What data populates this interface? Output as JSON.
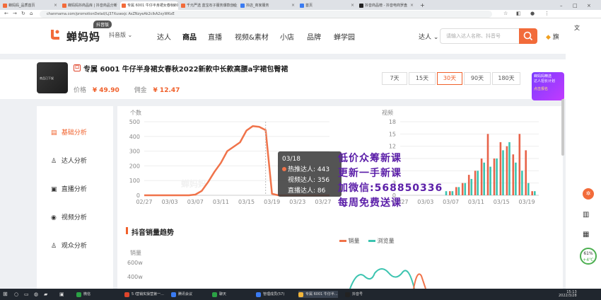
{
  "browser": {
    "tabs": [
      {
        "label": "蝉妈妈_品质首页",
        "color": "#f26b3a",
        "active": false
      },
      {
        "label": "蝉妈妈抖商品库 | 抖音商品分析",
        "color": "#f26b3a",
        "active": false
      },
      {
        "label": "专属 6001 牛仔半身裙女春秋2022新款",
        "color": "#f26b3a",
        "active": true
      },
      {
        "label": "千元严选 蓝宝石子服务爆款创业",
        "color": "#f26b3a",
        "active": false
      },
      {
        "label": "抖店_商家服务",
        "color": "#3a7bf2",
        "active": false
      },
      {
        "label": "首页",
        "color": "#3a7bf2",
        "active": false
      },
      {
        "label": "抖音商品榜 - 抖音电商罗盘",
        "color": "#222222",
        "active": false
      }
    ],
    "url": "chanmama.com/promotionDetail/Lj37Xusexjc AsZNzyeAk2clkA2xyWKxE"
  },
  "site": {
    "logo_text": "蝉妈妈",
    "logo_badge": "抖音版",
    "version_select": "抖音版",
    "nav": [
      "达人",
      "商品",
      "直播",
      "视频&素材",
      "小店",
      "品牌",
      "蝉学园"
    ],
    "search_scope": "达人",
    "search_placeholder": "请输入达人名称、抖音号",
    "flagship_label": "旗"
  },
  "product": {
    "badge": "口",
    "title": "专属 6001 牛仔半身裙女春秋2022新款中长款高腰a字裙包臀裙",
    "price_label": "价格",
    "price": "¥ 49.90",
    "commission_label": "佣金",
    "commission": "¥ 12.47",
    "thumb_caption": "商品已下架",
    "ranges": [
      "7天",
      "15天",
      "30天",
      "90天",
      "180天"
    ],
    "active_range": "30天"
  },
  "promo": {
    "line1": "蝉妈妈精选",
    "line2": "达人招长计划",
    "line3": "点击报名"
  },
  "sidebar": {
    "items": [
      {
        "label": "基础分析",
        "icon": "chart-icon",
        "active": true
      },
      {
        "label": "达人分析",
        "icon": "user-icon",
        "active": false
      },
      {
        "label": "直播分析",
        "icon": "tv-icon",
        "active": false
      },
      {
        "label": "视频分析",
        "icon": "play-icon",
        "active": false
      },
      {
        "label": "观众分析",
        "icon": "audience-icon",
        "active": false
      }
    ]
  },
  "chart_data": [
    {
      "type": "line",
      "ylabel": "个数",
      "ylim": [
        0,
        500
      ],
      "yticks": [
        0,
        100,
        200,
        300,
        400,
        500
      ],
      "x_tick_labels": [
        "02/27",
        "03/03",
        "03/07",
        "03/11",
        "03/15",
        "03/19",
        "03/23",
        "03/27"
      ],
      "x": [
        "02/27",
        "02/28",
        "03/01",
        "03/02",
        "03/03",
        "03/04",
        "03/05",
        "03/06",
        "03/07",
        "03/08",
        "03/09",
        "03/10",
        "03/11",
        "03/12",
        "03/13",
        "03/14",
        "03/15",
        "03/16",
        "03/17",
        "03/18",
        "03/19",
        "03/20",
        "03/21",
        "03/22",
        "03/23",
        "03/24",
        "03/25",
        "03/26",
        "03/27",
        "03/28"
      ],
      "series": [
        {
          "name": "热推达人",
          "color": "#f0734a",
          "values": [
            0,
            0,
            0,
            0,
            0,
            0,
            0,
            0,
            5,
            30,
            90,
            160,
            220,
            300,
            330,
            360,
            440,
            470,
            465,
            443,
            10,
            0,
            0,
            0,
            0,
            0,
            0,
            0,
            0,
            0
          ]
        }
      ],
      "watermark": "蝉妈妈"
    },
    {
      "type": "bar",
      "ylabel": "视频",
      "ylim": [
        0,
        18
      ],
      "yticks": [
        0,
        3,
        6,
        9,
        12,
        15,
        18
      ],
      "x_tick_labels": [
        "02/27",
        "03/03",
        "03/07",
        "03/11",
        "03/15",
        "03/19"
      ],
      "x": [
        "03/06",
        "03/07",
        "03/08",
        "03/09",
        "03/10",
        "03/11",
        "03/12",
        "03/13",
        "03/14",
        "03/15",
        "03/16",
        "03/17",
        "03/18",
        "03/19",
        "03/20"
      ],
      "series": [
        {
          "name": "视频达人",
          "color": "#e8634a",
          "values": [
            0,
            1,
            2,
            3,
            5,
            6,
            9,
            15,
            9,
            13,
            12,
            10,
            15,
            11,
            1
          ]
        },
        {
          "name": "",
          "color": "#3cc4b0",
          "values": [
            1,
            1,
            2,
            3,
            4,
            6,
            8,
            7,
            9,
            11,
            13,
            8,
            6,
            3,
            1
          ]
        }
      ]
    }
  ],
  "tooltip": {
    "date": "03/18",
    "rows": [
      {
        "label": "热推达人:",
        "value": "443",
        "color": "#f0734a"
      },
      {
        "label": "视频达人:",
        "value": "356",
        "color": ""
      },
      {
        "label": "直播达人:",
        "value": "86",
        "color": ""
      }
    ]
  },
  "overlay_ad": [
    "低价众筹新课",
    "更新一手新课",
    "加微信:568850336",
    "每周免费送课"
  ],
  "trend": {
    "title": "抖音销量趋势",
    "legend": [
      {
        "label": "销量",
        "color": "#f0734a"
      },
      {
        "label": "浏览量",
        "color": "#3cc4b0"
      }
    ],
    "ylabel": "销量",
    "yticks": [
      "600w",
      "400w"
    ]
  },
  "rail": {
    "badge": "61%",
    "badge_sub": "+4℃"
  },
  "taskbar": {
    "items": [
      "5 i营销实操营第一...",
      "腾讯会议",
      "聊天",
      "管理成员(57)",
      "专属 6001 牛仔半...",
      "抖音号"
    ],
    "wechat": "微信",
    "time": "15:13",
    "date": "2022/3/28"
  }
}
